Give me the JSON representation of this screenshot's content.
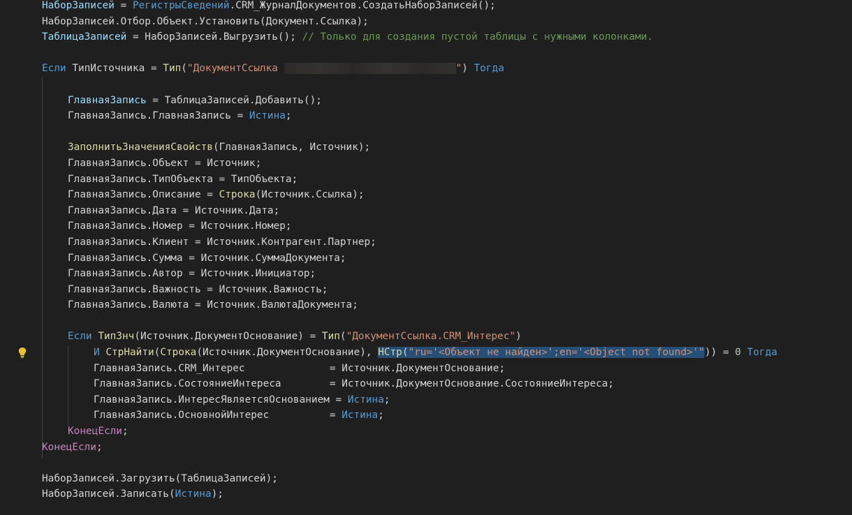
{
  "lines": [
    {
      "indent": 0,
      "tokens": [
        [
          "var",
          "НаборЗаписей"
        ],
        [
          "plain",
          " = "
        ],
        [
          "kw",
          "РегистрыСведений"
        ],
        [
          "plain",
          ".CRM_ЖурналДокументов.СоздатьНаборЗаписей();"
        ]
      ]
    },
    {
      "indent": 0,
      "tokens": [
        [
          "plain",
          "НаборЗаписей.Отбор.Объект.Установить(Документ.Ссылка);"
        ]
      ]
    },
    {
      "indent": 0,
      "tokens": [
        [
          "var",
          "ТаблицаЗаписей"
        ],
        [
          "plain",
          " = НаборЗаписей.Выгрузить(); "
        ],
        [
          "cmt",
          "// Только для создания пустой таблицы с нужными колонками."
        ]
      ]
    },
    {
      "indent": 0,
      "tokens": []
    },
    {
      "indent": 0,
      "tokens": [
        [
          "kw",
          "Если"
        ],
        [
          "plain",
          " ТипИсточника = "
        ],
        [
          "fn",
          "Тип"
        ],
        [
          "plain",
          "("
        ],
        [
          "str",
          "\"ДокументСсылка "
        ],
        [
          "blur",
          ""
        ],
        [
          "str",
          "\""
        ],
        [
          "plain",
          ") "
        ],
        [
          "kw",
          "Тогда"
        ]
      ]
    },
    {
      "indent": 0,
      "tokens": []
    },
    {
      "indent": 1,
      "tokens": [
        [
          "var",
          "ГлавнаяЗапись"
        ],
        [
          "plain",
          " = ТаблицаЗаписей.Добавить();"
        ]
      ]
    },
    {
      "indent": 1,
      "tokens": [
        [
          "plain",
          "ГлавнаяЗапись.ГлавнаяЗапись = "
        ],
        [
          "kw",
          "Истина"
        ],
        [
          "plain",
          ";"
        ]
      ]
    },
    {
      "indent": 1,
      "tokens": []
    },
    {
      "indent": 1,
      "tokens": [
        [
          "fn",
          "ЗаполнитьЗначенияСвойств"
        ],
        [
          "plain",
          "(ГлавнаяЗапись, Источник);"
        ]
      ]
    },
    {
      "indent": 1,
      "tokens": [
        [
          "plain",
          "ГлавнаяЗапись.Объект = Источник;"
        ]
      ]
    },
    {
      "indent": 1,
      "tokens": [
        [
          "plain",
          "ГлавнаяЗапись.ТипОбъекта = ТипОбъекта;"
        ]
      ]
    },
    {
      "indent": 1,
      "tokens": [
        [
          "plain",
          "ГлавнаяЗапись.Описание = "
        ],
        [
          "fn",
          "Строка"
        ],
        [
          "plain",
          "(Источник.Ссылка);"
        ]
      ]
    },
    {
      "indent": 1,
      "tokens": [
        [
          "plain",
          "ГлавнаяЗапись.Дата = Источник.Дата;"
        ]
      ]
    },
    {
      "indent": 1,
      "tokens": [
        [
          "plain",
          "ГлавнаяЗапись.Номер = Источник.Номер;"
        ]
      ]
    },
    {
      "indent": 1,
      "tokens": [
        [
          "plain",
          "ГлавнаяЗапись.Клиент = Источник.Контрагент.Партнер;"
        ]
      ]
    },
    {
      "indent": 1,
      "tokens": [
        [
          "plain",
          "ГлавнаяЗапись.Сумма = Источник.СуммаДокумента;"
        ]
      ]
    },
    {
      "indent": 1,
      "tokens": [
        [
          "plain",
          "ГлавнаяЗапись.Автор = Источник.Инициатор;"
        ]
      ]
    },
    {
      "indent": 1,
      "tokens": [
        [
          "plain",
          "ГлавнаяЗапись.Важность = Источник.Важность;"
        ]
      ]
    },
    {
      "indent": 1,
      "tokens": [
        [
          "plain",
          "ГлавнаяЗапись.Валюта = Источник.ВалютаДокумента;"
        ]
      ]
    },
    {
      "indent": 1,
      "tokens": []
    },
    {
      "indent": 1,
      "tokens": [
        [
          "kw",
          "Если"
        ],
        [
          "plain",
          " "
        ],
        [
          "fn",
          "ТипЗнч"
        ],
        [
          "plain",
          "(Источник.ДокументОснование) = "
        ],
        [
          "fn",
          "Тип"
        ],
        [
          "plain",
          "("
        ],
        [
          "str",
          "\"ДокументСсылка.CRM_Интерес\""
        ],
        [
          "plain",
          ")"
        ]
      ]
    },
    {
      "indent": 2,
      "tokens": [
        [
          "kw",
          "И"
        ],
        [
          "plain",
          " "
        ],
        [
          "fn",
          "СтрНайти"
        ],
        [
          "plain",
          "("
        ],
        [
          "fn",
          "Строка"
        ],
        [
          "plain",
          "(Источник.ДокументОснование), "
        ],
        [
          "sel-fn",
          "НСтр"
        ],
        [
          "sel-plain",
          "("
        ],
        [
          "sel-str",
          "\"ru='<Объект не найден>';en='<Object not found>'\""
        ],
        [
          "plain",
          ")) = "
        ],
        [
          "num",
          "0"
        ],
        [
          "plain",
          " "
        ],
        [
          "kw",
          "Тогда"
        ]
      ]
    },
    {
      "indent": 2,
      "tokens": [
        [
          "plain",
          "ГлавнаяЗапись.CRM_Интерес              = Источник.ДокументОснование;"
        ]
      ]
    },
    {
      "indent": 2,
      "tokens": [
        [
          "plain",
          "ГлавнаяЗапись.СостояниеИнтереса        = Источник.ДокументОснование.СостояниеИнтереса;"
        ]
      ]
    },
    {
      "indent": 2,
      "tokens": [
        [
          "plain",
          "ГлавнаяЗапись.ИнтересЯвляетсяОснованием = "
        ],
        [
          "kw",
          "Истина"
        ],
        [
          "plain",
          ";"
        ]
      ]
    },
    {
      "indent": 2,
      "tokens": [
        [
          "plain",
          "ГлавнаяЗапись.ОсновнойИнтерес          = "
        ],
        [
          "kw",
          "Истина"
        ],
        [
          "plain",
          ";"
        ]
      ]
    },
    {
      "indent": 1,
      "tokens": [
        [
          "ctrl",
          "КонецЕсли"
        ],
        [
          "plain",
          ";"
        ]
      ]
    },
    {
      "indent": 0,
      "tokens": [
        [
          "ctrl",
          "КонецЕсли"
        ],
        [
          "plain",
          ";"
        ]
      ]
    },
    {
      "indent": 0,
      "tokens": []
    },
    {
      "indent": 0,
      "tokens": [
        [
          "plain",
          "НаборЗаписей.Загрузить(ТаблицаЗаписей);"
        ]
      ]
    },
    {
      "indent": 0,
      "tokens": [
        [
          "plain",
          "НаборЗаписей.Записать("
        ],
        [
          "kw",
          "Истина"
        ],
        [
          "plain",
          ");"
        ]
      ]
    }
  ],
  "gutter": {
    "lightbulb_icon": "lightbulb-icon",
    "lightbulb_color": "#e8c22a"
  },
  "theme": {
    "background": "#1f1f1f",
    "selection": "#264f78"
  }
}
